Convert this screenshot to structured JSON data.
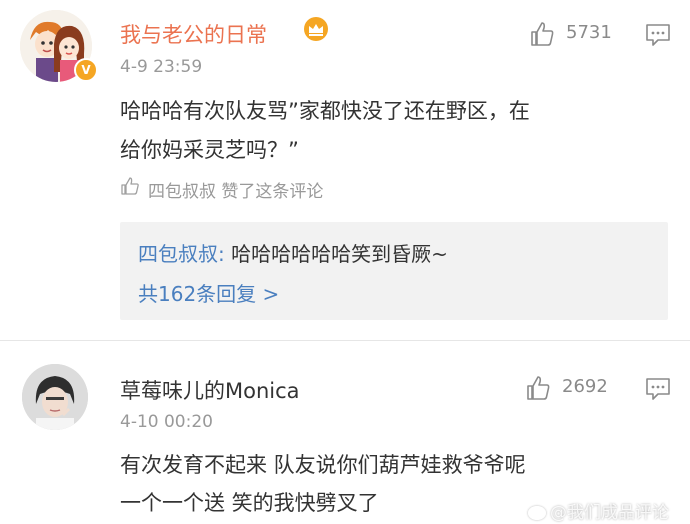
{
  "comments": [
    {
      "username": "我与老公的日常",
      "time": "4-9 23:59",
      "likes": "5731",
      "text_lines": [
        "哈哈哈有次队友骂”家都快没了还在野区，在",
        "给你妈采灵芝吗？”"
      ],
      "liked_by": "四包叔叔 赞了这条评论",
      "reply": {
        "author": "四包叔叔",
        "separator": ": ",
        "text": "哈哈哈哈哈哈笑到昏厥~",
        "more": "共162条回复 >"
      },
      "badges": [
        "crown-badge",
        "verified-v-badge"
      ]
    },
    {
      "username": "草莓味儿的Monica",
      "time": "4-10 00:20",
      "likes": "2692",
      "text_lines": [
        "有次发育不起来 队友说你们葫芦娃救爷爷呢",
        "一个一个送 笑的我快劈叉了"
      ]
    }
  ],
  "watermark": "@我们成品评论",
  "colors": {
    "username_vip": "#eb7350",
    "link_blue": "#4a7fbf",
    "meta_gray": "#999999",
    "reply_bg": "#f2f2f2"
  }
}
